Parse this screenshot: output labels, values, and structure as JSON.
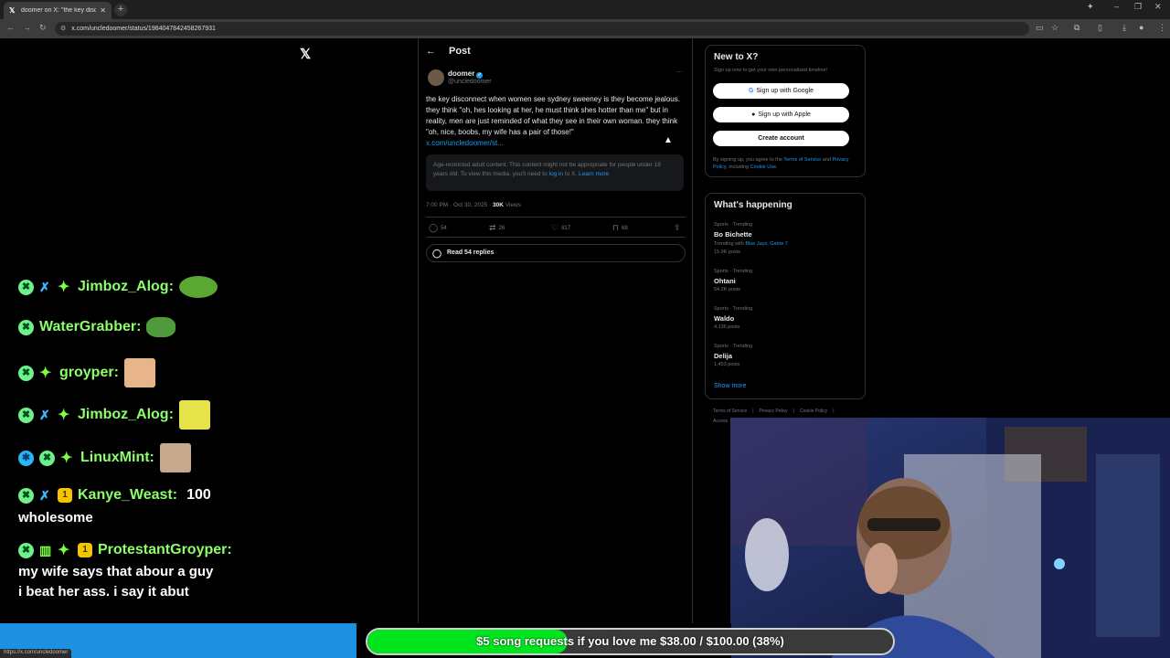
{
  "browser": {
    "tab_title": "doomer on X: \"the key disconn",
    "url": "x.com/uncledoomer/status/1984047842458267931",
    "status_url": "https://x.com/uncledoomer"
  },
  "post": {
    "header": "Post",
    "author_name": "doomer",
    "author_handle": "@uncledoomer",
    "text": "the key disconnect when women see sydney sweeney is they become jealous. they think \"oh, hes looking at her, he must think shes hotter than me\" but in reality, men are just reminded of what they see in their own woman. they think \"oh, nice, boobs, my wife has a pair of those!\"",
    "link": "x.com/uncledoomer/st...",
    "age_notice": "Age-restricted adult content. This content might not be appropriate for people under 18 years old. To view this media, you'll need to",
    "age_login": "log in",
    "age_mid": "to X.",
    "age_learn": "Learn more",
    "time": "7:00 PM · Oct 30, 2025 ·",
    "views_count": "30K",
    "views_label": "Views",
    "replies": "54",
    "reposts": "26",
    "likes": "817",
    "bookmarks": "68",
    "read_replies": "Read 54 replies"
  },
  "signup": {
    "title": "New to X?",
    "subtitle": "Sign up now to get your own personalized timeline!",
    "google": "Sign up with Google",
    "apple": "Sign up with Apple",
    "create": "Create account",
    "legal_prefix": "By signing up, you agree to the",
    "terms": "Terms of Service",
    "and": "and",
    "privacy": "Privacy Policy",
    "including": ", including",
    "cookie": "Cookie Use."
  },
  "trends": {
    "title": "What's happening",
    "items": [
      {
        "category": "Sports · Trending",
        "name": "Bo Bichette",
        "extra_prefix": "Trending with",
        "extra_link": "Blue Jays, Game 7",
        "posts": "15.9K posts"
      },
      {
        "category": "Sports · Trending",
        "name": "Ohtani",
        "posts": "54.2K posts"
      },
      {
        "category": "Sports · Trending",
        "name": "Waldo",
        "posts": "4,136 posts"
      },
      {
        "category": "Sports · Trending",
        "name": "Delija",
        "posts": "1,453 posts"
      }
    ],
    "show_more": "Show more"
  },
  "footer": {
    "terms": "Terms of Service",
    "privacy": "Privacy Policy",
    "cookie": "Cookie Policy",
    "accessibility": "Access"
  },
  "chat": [
    {
      "user": "Jimboz_Alog:"
    },
    {
      "user": "WaterGrabber:"
    },
    {
      "user": "groyper:"
    },
    {
      "user": "Jimboz_Alog:"
    },
    {
      "user": "LinuxMint:"
    },
    {
      "user": "Kanye_Weast:",
      "msg_inline": "100",
      "msg": "wholesome"
    },
    {
      "user": "ProtestantGroyper:",
      "msg": "my wife says that abour a guy",
      "msg2": "i beat her ass. i say it abut"
    }
  ],
  "goal": {
    "text": "$5 song requests if you love me $38.00 / $100.00 (38%)",
    "fraction": 0.38,
    "fill_color": "#00e51d"
  },
  "colors": {
    "x_blue": "#1d9bf0",
    "chat_green": "#8cff6a",
    "stream_blue": "#1e90e0"
  }
}
